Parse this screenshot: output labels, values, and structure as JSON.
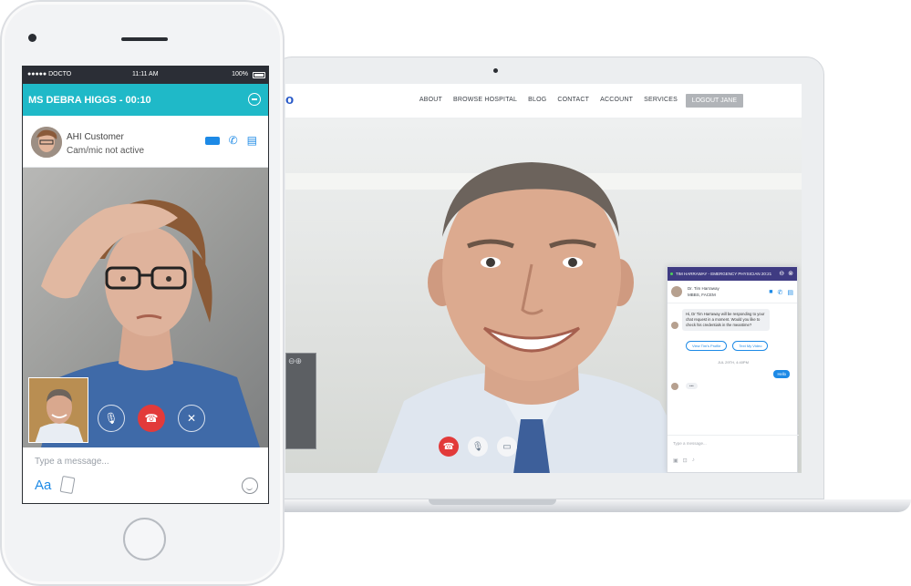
{
  "laptop": {
    "nav": {
      "logo": "o",
      "links": [
        "ABOUT",
        "BROWSE HOSPITAL",
        "BLOG",
        "CONTACT",
        "ACCOUNT",
        "SERVICES"
      ],
      "logout": "LOGOUT JANE"
    },
    "call_controls": [
      "hang-up-icon",
      "microphone-icon",
      "camera-icon"
    ],
    "chat": {
      "header": "TIM HARRAWAY - EMERGENCY PHYSICIAN  20:21",
      "doctor_name": "Dr. Tim Harraway",
      "doctor_credentials": "MBBS, FACEM",
      "message": "Hi, Dr Tim Harraway will be responding to your chat request in a moment. Would you like to check his credentials in the meantime?",
      "buttons": [
        "View Tim's Profile",
        "Text My Video"
      ],
      "timestamp": "JUL 29TH, 4:40PM",
      "reply": "Hello",
      "typing": "•••",
      "input_placeholder": "Type a message..."
    }
  },
  "phone": {
    "status_bar": {
      "carrier": "●●●●● DOCTO",
      "time": "11:11 AM",
      "battery": "100%"
    },
    "call_header": "MS DEBRA HIGGS - 00:10",
    "contact": {
      "name": "AHI Customer",
      "status": "Cam/mic not active"
    },
    "call_controls": [
      "mute-microphone-icon",
      "hang-up-icon",
      "speaker-off-icon"
    ],
    "message_placeholder": "Type a message...",
    "format_label": "Aa"
  },
  "colors": {
    "teal": "#1fb9c8",
    "blue": "#1d8ae6",
    "red": "#e23a3a",
    "purple": "#3f3b82"
  }
}
